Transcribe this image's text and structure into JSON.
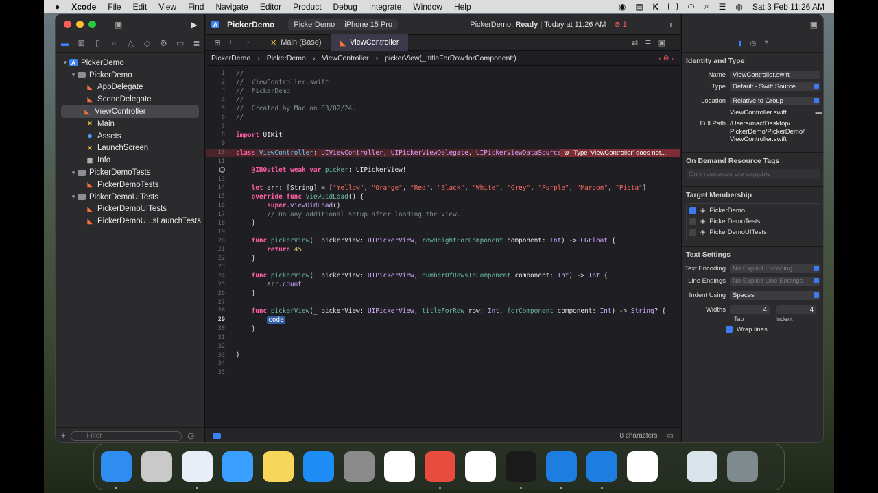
{
  "menubar": {
    "apple": "",
    "app": "Xcode",
    "items": [
      "File",
      "Edit",
      "View",
      "Find",
      "Navigate",
      "Editor",
      "Product",
      "Debug",
      "Integrate",
      "Window",
      "Help"
    ],
    "clock": "Sat 3 Feb  11:26 AM"
  },
  "project": {
    "name": "PickerDemo"
  },
  "navigator": {
    "filter_placeholder": "Filter",
    "items": [
      {
        "label": "PickerDemo",
        "type": "proj",
        "indent": 0,
        "disc": "▾"
      },
      {
        "label": "PickerDemo",
        "type": "folder",
        "indent": 1,
        "disc": "▾"
      },
      {
        "label": "AppDelegate",
        "type": "swift",
        "indent": 2
      },
      {
        "label": "SceneDelegate",
        "type": "swift",
        "indent": 2
      },
      {
        "label": "ViewController",
        "type": "swift",
        "indent": 2,
        "selected": true
      },
      {
        "label": "Main",
        "type": "xib",
        "indent": 2
      },
      {
        "label": "Assets",
        "type": "asset",
        "indent": 2
      },
      {
        "label": "LaunchScreen",
        "type": "xib",
        "indent": 2
      },
      {
        "label": "Info",
        "type": "plist",
        "indent": 2
      },
      {
        "label": "PickerDemoTests",
        "type": "folder",
        "indent": 1,
        "disc": "▾"
      },
      {
        "label": "PickerDemoTests",
        "type": "swift",
        "indent": 2
      },
      {
        "label": "PickerDemoUITests",
        "type": "folder",
        "indent": 1,
        "disc": "▾"
      },
      {
        "label": "PickerDemoUITests",
        "type": "swift",
        "indent": 2
      },
      {
        "label": "PickerDemoU...sLaunchTests",
        "type": "swift",
        "indent": 2
      }
    ]
  },
  "toolbar": {
    "scheme": "PickerDemo",
    "device": "iPhone 15 Pro",
    "status_prefix": "PickerDemo:",
    "status_ready": "Ready",
    "status_time": "Today at 11:26 AM",
    "error_count": "1"
  },
  "tabs": [
    "Main (Base)",
    "ViewController"
  ],
  "breadcrumb": [
    "PickerDemo",
    "PickerDemo",
    "ViewController",
    "pickerView(_:titleForRow:forComponent:)"
  ],
  "error_message": "Type 'ViewController' does not...",
  "code": [
    [
      [
        "cm",
        "//"
      ]
    ],
    [
      [
        "cm",
        "//  ViewController.swift"
      ]
    ],
    [
      [
        "cm",
        "//  PickerDemo"
      ]
    ],
    [
      [
        "cm",
        "//"
      ]
    ],
    [
      [
        "cm",
        "//  Created by Mac on 03/02/24."
      ]
    ],
    [
      [
        "cm",
        "//"
      ]
    ],
    [],
    [
      [
        "kw",
        "import"
      ],
      [
        "pl",
        " UIKit"
      ]
    ],
    [],
    [
      [
        "kw",
        "class"
      ],
      [
        "pl",
        " "
      ],
      [
        "cls",
        "ViewController"
      ],
      [
        "pl",
        ": "
      ],
      [
        "ty",
        "UIViewController"
      ],
      [
        "pl",
        ", "
      ],
      [
        "ty",
        "UIPickerViewDelegate"
      ],
      [
        "pl",
        ", "
      ],
      [
        "ty",
        "UIPickerViewDataSource"
      ],
      [
        "pl",
        " {"
      ]
    ],
    [],
    [
      [
        "pl",
        "    "
      ],
      [
        "kw",
        "@IBOutlet"
      ],
      [
        "pl",
        " "
      ],
      [
        "kw",
        "weak"
      ],
      [
        "pl",
        " "
      ],
      [
        "kw",
        "var"
      ],
      [
        "pl",
        " "
      ],
      [
        "fn",
        "picker"
      ],
      [
        "pl",
        ": UIPickerView!"
      ]
    ],
    [],
    [
      [
        "pl",
        "    "
      ],
      [
        "kw",
        "let"
      ],
      [
        "pl",
        " arr: ["
      ],
      [
        "pl",
        "String"
      ],
      [
        "pl",
        "] = ["
      ],
      [
        "st",
        "\"Yellow\""
      ],
      [
        "pl",
        ", "
      ],
      [
        "st",
        "\"Orange\""
      ],
      [
        "pl",
        ", "
      ],
      [
        "st",
        "\"Red\""
      ],
      [
        "pl",
        ", "
      ],
      [
        "st",
        "\"Black\""
      ],
      [
        "pl",
        ", "
      ],
      [
        "st",
        "\"White\""
      ],
      [
        "pl",
        ", "
      ],
      [
        "st",
        "\"Grey\""
      ],
      [
        "pl",
        ", "
      ],
      [
        "st",
        "\"Purple\""
      ],
      [
        "pl",
        ", "
      ],
      [
        "st",
        "\"Maroon\""
      ],
      [
        "pl",
        ", "
      ],
      [
        "st",
        "\"Pista\""
      ],
      [
        "pl",
        "]"
      ]
    ],
    [
      [
        "pl",
        "    "
      ],
      [
        "kw",
        "override"
      ],
      [
        "pl",
        " "
      ],
      [
        "kw",
        "func"
      ],
      [
        "pl",
        " "
      ],
      [
        "fn",
        "viewDidLoad"
      ],
      [
        "pl",
        "() {"
      ]
    ],
    [
      [
        "pl",
        "        "
      ],
      [
        "kw",
        "super"
      ],
      [
        "pl",
        "."
      ],
      [
        "ty",
        "viewDidLoad"
      ],
      [
        "pl",
        "()"
      ]
    ],
    [
      [
        "pl",
        "        "
      ],
      [
        "cm",
        "// Do any additional setup after loading the view."
      ]
    ],
    [
      [
        "pl",
        "    }"
      ]
    ],
    [],
    [
      [
        "pl",
        "    "
      ],
      [
        "kw",
        "func"
      ],
      [
        "pl",
        " "
      ],
      [
        "fn",
        "pickerView"
      ],
      [
        "pl",
        "(_ pickerView: "
      ],
      [
        "ty",
        "UIPickerView"
      ],
      [
        "pl",
        ", "
      ],
      [
        "fn",
        "rowHeightForComponent"
      ],
      [
        "pl",
        " component: "
      ],
      [
        "ty",
        "Int"
      ],
      [
        "pl",
        ") -> "
      ],
      [
        "ty",
        "CGFloat"
      ],
      [
        "pl",
        " {"
      ]
    ],
    [
      [
        "pl",
        "        "
      ],
      [
        "kw",
        "return"
      ],
      [
        "pl",
        " "
      ],
      [
        "nm",
        "45"
      ]
    ],
    [
      [
        "pl",
        "    }"
      ]
    ],
    [],
    [
      [
        "pl",
        "    "
      ],
      [
        "kw",
        "func"
      ],
      [
        "pl",
        " "
      ],
      [
        "fn",
        "pickerView"
      ],
      [
        "pl",
        "(_ pickerView: "
      ],
      [
        "ty",
        "UIPickerView"
      ],
      [
        "pl",
        ", "
      ],
      [
        "fn",
        "numberOfRowsInComponent"
      ],
      [
        "pl",
        " component: "
      ],
      [
        "ty",
        "Int"
      ],
      [
        "pl",
        ") -> "
      ],
      [
        "ty",
        "Int"
      ],
      [
        "pl",
        " {"
      ]
    ],
    [
      [
        "pl",
        "        arr."
      ],
      [
        "ty",
        "count"
      ]
    ],
    [
      [
        "pl",
        "    }"
      ]
    ],
    [],
    [
      [
        "pl",
        "    "
      ],
      [
        "kw",
        "func"
      ],
      [
        "pl",
        " "
      ],
      [
        "fn",
        "pickerView"
      ],
      [
        "pl",
        "(_ pickerView: "
      ],
      [
        "ty",
        "UIPickerView"
      ],
      [
        "pl",
        ", "
      ],
      [
        "fn",
        "titleForRow"
      ],
      [
        "pl",
        " row: "
      ],
      [
        "ty",
        "Int"
      ],
      [
        "pl",
        ", "
      ],
      [
        "fn",
        "forComponent"
      ],
      [
        "pl",
        " component: "
      ],
      [
        "ty",
        "Int"
      ],
      [
        "pl",
        ") -> "
      ],
      [
        "ty",
        "String"
      ],
      [
        "pl",
        "? {"
      ]
    ],
    [
      [
        "pl",
        "        "
      ],
      [
        "tok",
        "code"
      ]
    ],
    [
      [
        "pl",
        "    }"
      ]
    ],
    [],
    [],
    [
      [
        "pl",
        "}"
      ]
    ],
    [],
    []
  ],
  "editor_footer": {
    "chars": "8 characters"
  },
  "inspector": {
    "identity_title": "Identity and Type",
    "name_label": "Name",
    "name_value": "ViewController.swift",
    "type_label": "Type",
    "type_value": "Default - Swift Source",
    "location_label": "Location",
    "location_value": "Relative to Group",
    "location_file": "ViewController.swift",
    "fullpath_label": "Full Path",
    "fullpath_lines": [
      "/Users/mac/Desktop/",
      "PickerDemo/PickerDemo/",
      "ViewController.swift"
    ],
    "odr_title": "On Demand Resource Tags",
    "odr_placeholder": "Only resources are taggable",
    "target_title": "Target Membership",
    "targets": [
      {
        "label": "PickerDemo",
        "checked": true
      },
      {
        "label": "PickerDemoTests",
        "checked": false
      },
      {
        "label": "PickerDemoUITests",
        "checked": false
      }
    ],
    "text_title": "Text Settings",
    "encoding_label": "Text Encoding",
    "encoding_value": "No Explicit Encoding",
    "endings_label": "Line Endings",
    "endings_value": "No Explicit Line Endings",
    "indent_label": "Indent Using",
    "indent_value": "Spaces",
    "widths_label": "Widths",
    "tab_value": "4",
    "indent_width": "4",
    "tab_caption": "Tab",
    "indent_caption": "Indent",
    "wrap_label": "Wrap lines"
  },
  "dock": [
    {
      "name": "finder",
      "color": "#2f8cf0"
    },
    {
      "name": "launchpad",
      "color": "#c9c9c9"
    },
    {
      "name": "safari",
      "color": "#e8eef5"
    },
    {
      "name": "mail",
      "color": "#3aa0ff"
    },
    {
      "name": "notes",
      "color": "#f7d65a"
    },
    {
      "name": "app-store",
      "color": "#1e8cf5"
    },
    {
      "name": "system-settings",
      "color": "#8a8a8a"
    },
    {
      "name": "slack",
      "color": "#ffffff"
    },
    {
      "name": "chrome",
      "color": "#e74c3c"
    },
    {
      "name": "instruments",
      "color": "#ffffff"
    },
    {
      "name": "terminal",
      "color": "#1a1a1a"
    },
    {
      "name": "xcode-beta",
      "color": "#1e7de0"
    },
    {
      "name": "xcode",
      "color": "#1e7de0"
    },
    {
      "name": "todo",
      "color": "#ffffff"
    },
    {
      "name": "preview",
      "color": "#d8e3ea"
    },
    {
      "name": "trash",
      "color": "#7e8a8e"
    }
  ]
}
